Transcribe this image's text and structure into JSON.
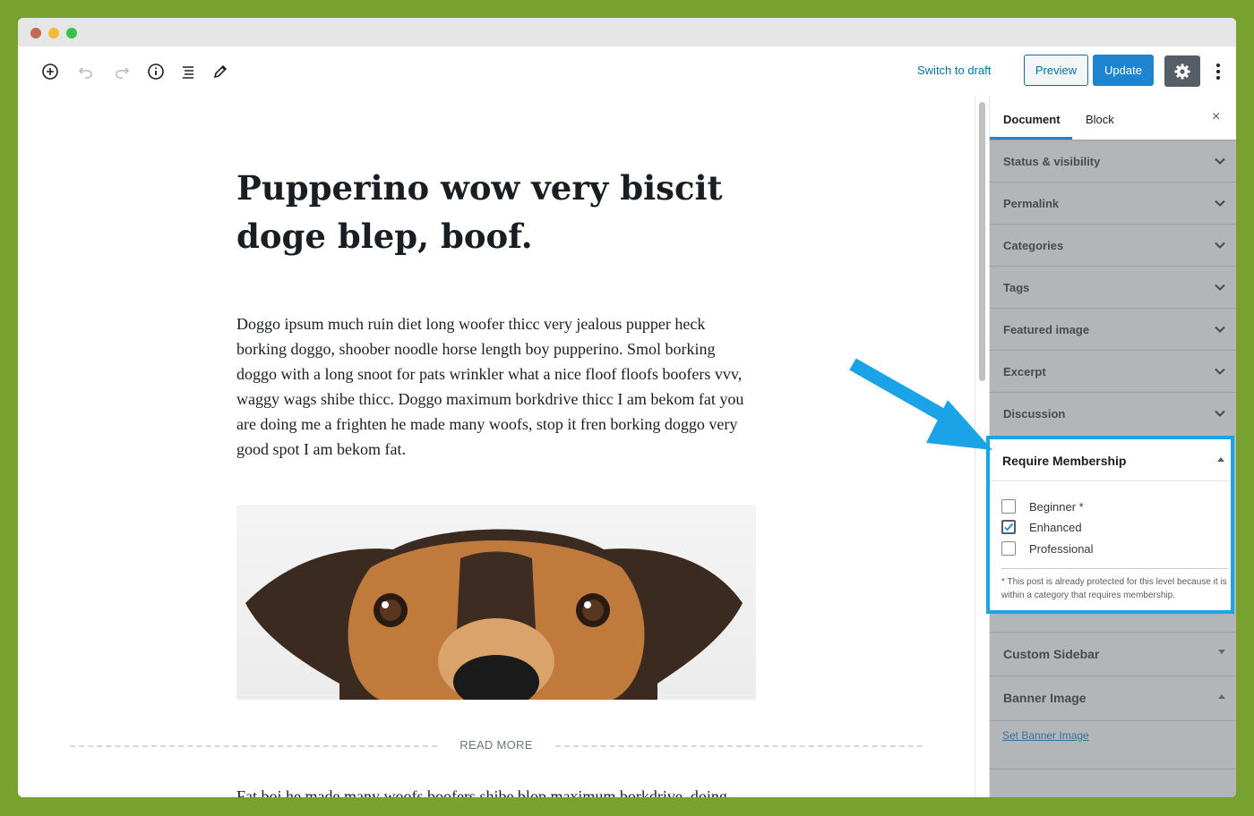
{
  "toolbar": {
    "switch_to_draft": "Switch to draft",
    "preview": "Preview",
    "update": "Update",
    "icons": [
      "add-block-icon",
      "undo-icon",
      "redo-icon",
      "info-icon",
      "list-view-icon",
      "edit-pencil-icon",
      "gear-icon",
      "more-vertical-icon"
    ]
  },
  "post": {
    "title": "Pupperino wow very biscit doge blep, boof.",
    "paragraph": "Doggo ipsum much ruin diet long woofer thicc very jealous pupper heck borking doggo, shoober noodle horse length boy pupperino. Smol borking doggo with a long snoot for pats wrinkler what a nice floof floofs boofers vvv, waggy wags shibe thicc. Doggo maximum borkdrive thicc I am bekom fat you are doing me a frighten he made many woofs, stop it fren borking doggo very good spot I am bekom fat.",
    "read_more": "READ MORE",
    "paragraph2": "Fat boi he made many woofs boofers shibe blop maximum borkdrive, doing"
  },
  "sidebar": {
    "tabs": [
      "Document",
      "Block"
    ],
    "active_tab": "Document",
    "close": "×",
    "panels": [
      "Status & visibility",
      "Permalink",
      "Categories",
      "Tags",
      "Featured image",
      "Excerpt",
      "Discussion"
    ],
    "membership": {
      "title": "Require Membership",
      "options": [
        {
          "label": "Beginner *",
          "checked": false
        },
        {
          "label": "Enhanced",
          "checked": true
        },
        {
          "label": "Professional",
          "checked": false
        }
      ],
      "note": "* This post is already protected for this level because it is within a category that requires membership."
    },
    "custom_sidebar": "Custom Sidebar",
    "banner_image": "Banner Image",
    "set_banner_image": "Set Banner Image"
  },
  "colors": {
    "background": "#78a22f",
    "accent": "#1f84d0",
    "highlight": "#1aa3e6"
  }
}
